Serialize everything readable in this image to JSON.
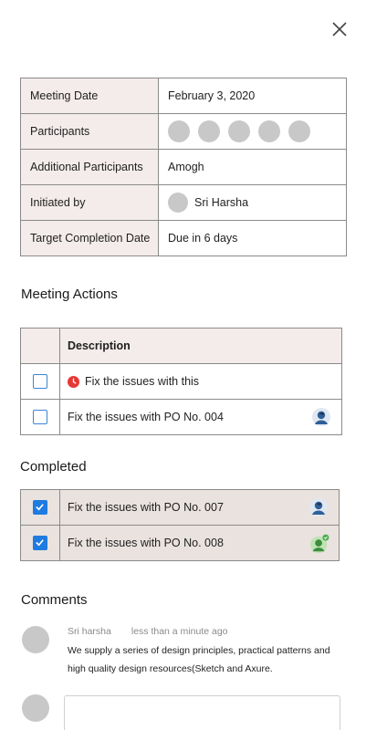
{
  "info": {
    "meeting_date_label": "Meeting Date",
    "meeting_date_value": "February 3, 2020",
    "participants_label": "Participants",
    "additional_label": "Additional Participants",
    "additional_value": "Amogh",
    "initiated_label": "Initiated by",
    "initiated_value": "Sri Harsha",
    "target_label": "Target Completion Date",
    "target_value": "Due in 6 days"
  },
  "actions": {
    "title": "Meeting Actions",
    "header": "Description",
    "items": [
      {
        "text": "Fix the issues with this",
        "icon": "clock-icon",
        "checked": false
      },
      {
        "text": "Fix the issues with PO No. 004",
        "icon": "avatar",
        "checked": false
      }
    ]
  },
  "completed": {
    "title": "Completed",
    "items": [
      {
        "text": "Fix the issues with PO No. 007",
        "checked": true
      },
      {
        "text": "Fix the issues with PO No. 008",
        "checked": true
      }
    ]
  },
  "comments": {
    "title": "Comments",
    "items": [
      {
        "author": "Sri harsha",
        "time": "less than a minute ago",
        "text": "We supply a series of design principles, practical patterns and high quality design resources(Sketch and Axure."
      }
    ],
    "input_placeholder": ""
  },
  "colors": {
    "label_bg": "#f3ecea",
    "completed_bg": "#e9e2df",
    "checkbox_blue": "#1e7be0",
    "clock_red": "#e53935"
  }
}
